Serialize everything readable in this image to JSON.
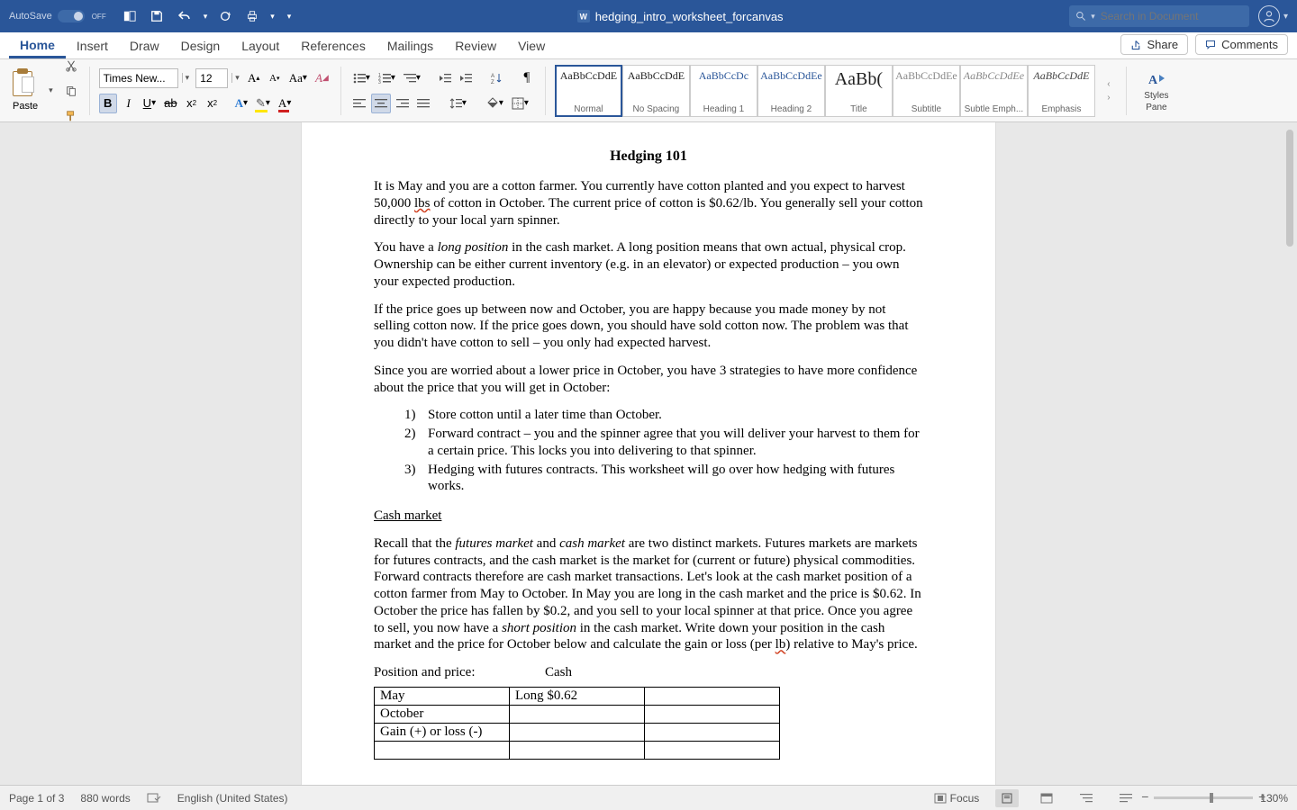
{
  "titlebar": {
    "autosave_label": "AutoSave",
    "autosave_state": "OFF",
    "doc_title": "hedging_intro_worksheet_forcanvas",
    "search_placeholder": "Search in Document"
  },
  "tabs": [
    "Home",
    "Insert",
    "Draw",
    "Design",
    "Layout",
    "References",
    "Mailings",
    "Review",
    "View"
  ],
  "active_tab": "Home",
  "share_label": "Share",
  "comments_label": "Comments",
  "ribbon": {
    "paste_label": "Paste",
    "font_name": "Times New...",
    "font_size": "12",
    "styles": [
      {
        "sample": "AaBbCcDdE",
        "label": "Normal",
        "color": "#222",
        "italic": false
      },
      {
        "sample": "AaBbCcDdE",
        "label": "No Spacing",
        "color": "#222",
        "italic": false
      },
      {
        "sample": "AaBbCcDc",
        "label": "Heading 1",
        "color": "#2a5699",
        "italic": false
      },
      {
        "sample": "AaBbCcDdEe",
        "label": "Heading 2",
        "color": "#2a5699",
        "italic": false
      },
      {
        "sample": "AaBb(",
        "label": "Title",
        "color": "#222",
        "italic": false
      },
      {
        "sample": "AaBbCcDdEe",
        "label": "Subtitle",
        "color": "#888",
        "italic": false
      },
      {
        "sample": "AaBbCcDdEe",
        "label": "Subtle Emph...",
        "color": "#888",
        "italic": true
      },
      {
        "sample": "AaBbCcDdE",
        "label": "Emphasis",
        "color": "#444",
        "italic": true
      }
    ],
    "selected_style": 0,
    "styles_pane_label1": "Styles",
    "styles_pane_label2": "Pane"
  },
  "document": {
    "title": "Hedging 101",
    "p1a": "It is May and you are a cotton farmer. You currently have cotton planted and you expect to harvest 50,000 ",
    "p1_lbs": "lbs",
    "p1b": " of cotton in October. The current price of cotton is $0.62/lb. You generally sell your cotton directly to your local yarn spinner.",
    "p2a": "You have a ",
    "p2_long": "long position",
    "p2b": " in the cash market. A long position means that own actual, physical crop. Ownership can be either current inventory (e.g. in an elevator) or expected production – you own your expected production.",
    "p3": "If the price goes up between now and October, you are happy because you made money by not selling cotton now. If the price goes down, you should have sold cotton now. The problem was that you didn't have cotton to sell – you only had expected harvest.",
    "p4": "Since you are worried about a lower price in October, you have 3 strategies to have more confidence about the price that you will get in October:",
    "list": [
      "Store cotton until a later time than October.",
      "Forward contract – you and the spinner agree that you will deliver your harvest to them for a certain price. This locks you into delivering to that spinner.",
      "Hedging with futures contracts. This worksheet will go over how hedging with futures works."
    ],
    "cash_heading": "Cash market",
    "p5a": "Recall that the ",
    "p5_fm": "futures market",
    "p5b": " and ",
    "p5_cm": "cash market",
    "p5c": " are two distinct markets. Futures markets are markets for futures contracts, and the cash market is the market for (current or future) physical commodities. Forward contracts therefore are cash market transactions. Let's look at the cash market position of a cotton farmer from May to October. In May you are long in the cash market and the price is $0.62. In October the price has fallen by $0.2, and you sell to your local spinner at that price. Once you agree to sell, you now have a ",
    "p5_sp": "short position",
    "p5d": " in the cash market. Write down your position in the cash market and the price for October below and calculate the gain or loss (per ",
    "p5_lb": "lb",
    "p5e": ") relative to May's price.",
    "pos_label": "Position and price:",
    "pos_cash": "Cash",
    "table": {
      "rows": [
        [
          "May",
          "Long $0.62",
          ""
        ],
        [
          "October",
          "",
          ""
        ],
        [
          "Gain (+) or loss (-)",
          "",
          ""
        ],
        [
          "",
          "",
          ""
        ]
      ]
    }
  },
  "status": {
    "page": "Page 1 of 3",
    "words": "880 words",
    "lang": "English (United States)",
    "focus": "Focus",
    "zoom": "130%"
  }
}
